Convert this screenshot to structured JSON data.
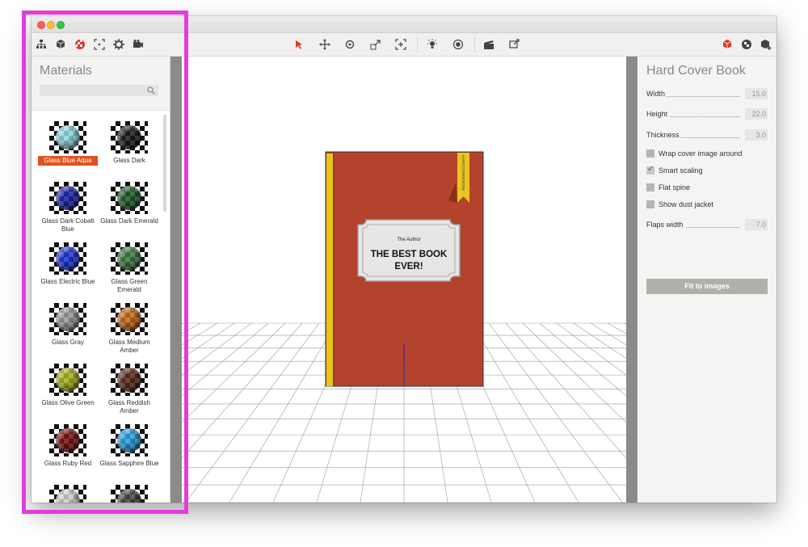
{
  "toolbar": {
    "left_icons": [
      "hierarchy-icon",
      "cube-icon",
      "material-ball-icon",
      "frame-icon",
      "gear-icon",
      "camera-icon"
    ],
    "center_icons": [
      "select-arrow-icon",
      "move-icon",
      "rotate-icon",
      "scale-icon",
      "fit-icon",
      "light-icon",
      "environment-icon",
      "clapboard-icon",
      "render-icon"
    ],
    "right_icons": [
      "red-cube-icon",
      "material-cube-icon",
      "add-cube-icon"
    ]
  },
  "left_panel": {
    "title": "Materials",
    "search_placeholder": "",
    "materials": [
      {
        "name": "Glass Blue Aqua",
        "color": "#8fd8e0",
        "selected": true
      },
      {
        "name": "Glass Dark",
        "color": "#1a1a1a",
        "selected": false
      },
      {
        "name": "Glass Dark Cobalt Blue",
        "color": "#1a24a8",
        "selected": false
      },
      {
        "name": "Glass Dark Emerald",
        "color": "#1f5a28",
        "selected": false
      },
      {
        "name": "Glass Electric Blue",
        "color": "#1b34d8",
        "selected": false
      },
      {
        "name": "Glass Green Emerald",
        "color": "#3e7a40",
        "selected": false
      },
      {
        "name": "Glass Gray",
        "color": "#9a9a9a",
        "selected": false
      },
      {
        "name": "Glass Medium Amber",
        "color": "#c46a1a",
        "selected": false
      },
      {
        "name": "Glass Olive Green",
        "color": "#a6b21c",
        "selected": false
      },
      {
        "name": "Glass Reddish Amber",
        "color": "#5a2a1a",
        "selected": false
      },
      {
        "name": "Glass Ruby Red",
        "color": "#7a1010",
        "selected": false
      },
      {
        "name": "Glass Sapphire Blue",
        "color": "#2aa0e0",
        "selected": false
      },
      {
        "name": "",
        "color": "#d0d0d0",
        "selected": false
      },
      {
        "name": "",
        "color": "#444444",
        "selected": false
      }
    ]
  },
  "viewport": {
    "book_author": "The Author",
    "book_title_line1": "THE BEST BOOK",
    "book_title_line2": "EVER!",
    "ribbon_text": "HARD COVER BOOK",
    "cover_color": "#b3432c",
    "spine_color": "#e9c51c"
  },
  "right_panel": {
    "title": "Hard Cover Book",
    "width_label": "Width",
    "width_value": "15.0",
    "height_label": "Height",
    "height_value": "22.0",
    "thickness_label": "Thickness",
    "thickness_value": "3.0",
    "wrap_label": "Wrap cover image around",
    "wrap_checked": false,
    "smart_label": "Smart scaling",
    "smart_checked": true,
    "flat_label": "Flat spine",
    "flat_checked": false,
    "dust_label": "Show dust jacket",
    "dust_checked": false,
    "flaps_label": "Flaps width",
    "flaps_value": "7.0",
    "fit_button": "Fit to images"
  },
  "accent_color": "#e23be0"
}
